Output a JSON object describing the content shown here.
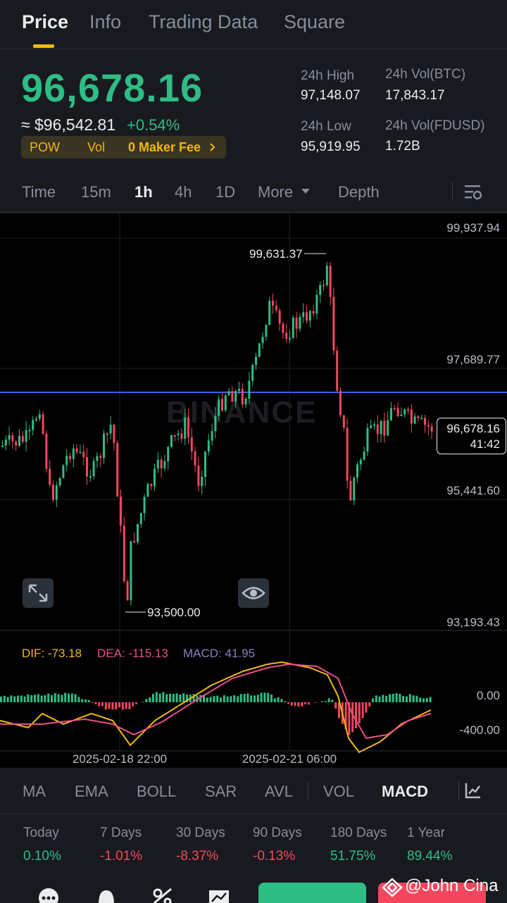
{
  "tabs": [
    "Price",
    "Info",
    "Trading Data",
    "Square"
  ],
  "price": {
    "last": "96,678.16",
    "usd": "≈ $96,542.81",
    "change": "+0.54%",
    "tags": [
      "POW",
      "Vol",
      "0 Maker Fee"
    ]
  },
  "stats": {
    "high_label": "24h High",
    "high_value": "97,148.07",
    "vol_btc_label": "24h Vol(BTC)",
    "vol_btc_value": "17,843.17",
    "low_label": "24h Low",
    "low_value": "95,919.95",
    "vol_fdusd_label": "24h Vol(FDUSD)",
    "vol_fdusd_value": "1.72B"
  },
  "intervals": [
    "Time",
    "15m",
    "1h",
    "4h",
    "1D",
    "More",
    "Depth"
  ],
  "chart": {
    "axis_labels": [
      "99,937.94",
      "97,689.77",
      "95,441.60",
      "93,193.43"
    ],
    "high_marker": "99,631.37",
    "low_marker": "93,500.00",
    "current_price": "96,678.16",
    "countdown": "41:42",
    "watermark": "BINANCE",
    "macd_header": {
      "dif": "DIF: -73.18",
      "dea": "DEA: -115.13",
      "macd": "MACD: 41.95"
    },
    "macd_axis": [
      "0.00",
      "-400.00"
    ],
    "dates": [
      "2025-02-18 22:00",
      "2025-02-21 06:00"
    ]
  },
  "indicators": [
    "MA",
    "EMA",
    "BOLL",
    "SAR",
    "AVL",
    "VOL",
    "MACD"
  ],
  "performance": [
    {
      "label": "Today",
      "value": "0.10%",
      "dir": "up"
    },
    {
      "label": "7 Days",
      "value": "-1.01%",
      "dir": "down"
    },
    {
      "label": "30 Days",
      "value": "-8.37%",
      "dir": "down"
    },
    {
      "label": "90 Days",
      "value": "-0.13%",
      "dir": "down"
    },
    {
      "label": "180 Days",
      "value": "51.75%",
      "dir": "up"
    },
    {
      "label": "1 Year",
      "value": "89.44%",
      "dir": "up"
    }
  ],
  "signature": "@John Cina",
  "colors": {
    "up": "#2ebd85",
    "down": "#f6465d",
    "accent": "#f0b90b",
    "dif": "#f0b90b",
    "dea": "#e8508a",
    "macd": "#8e7cc3"
  }
}
